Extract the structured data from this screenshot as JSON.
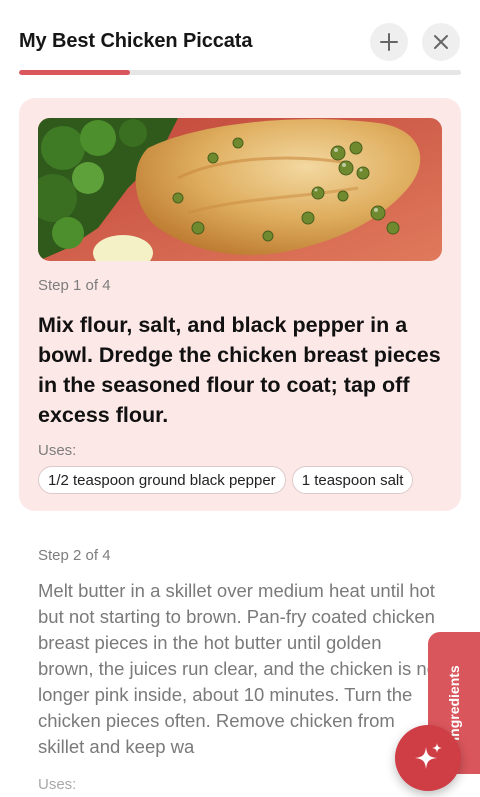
{
  "header": {
    "title": "My Best Chicken Piccata",
    "add_icon": "plus-icon",
    "close_icon": "close-icon",
    "progress_fraction": 0.25
  },
  "steps": [
    {
      "label": "Step 1 of 4",
      "text": "Mix flour, salt, and black pepper in a bowl. Dredge the chicken breast pieces in the seasoned flour to coat; tap off excess flour.",
      "uses_label": "Uses:",
      "uses": [
        "1/2 teaspoon ground black pepper",
        "1 teaspoon salt"
      ]
    },
    {
      "label": "Step 2 of 4",
      "text": "Melt butter in a skillet over medium heat until hot but not starting to brown. Pan-fry coated chicken breast pieces in the hot butter until golden brown, the juices run clear, and the chicken is no longer pink inside, about 10 minutes. Turn the chicken pieces often. Remove chicken from skillet and keep wa",
      "uses_label": "Uses:"
    }
  ],
  "ingredients_tab": {
    "label": "Ingredients"
  },
  "fab": {
    "icon": "sparkle-icon"
  },
  "colors": {
    "accent": "#d9565c",
    "active_card": "#fde8e8",
    "fab": "#cf3d45"
  }
}
